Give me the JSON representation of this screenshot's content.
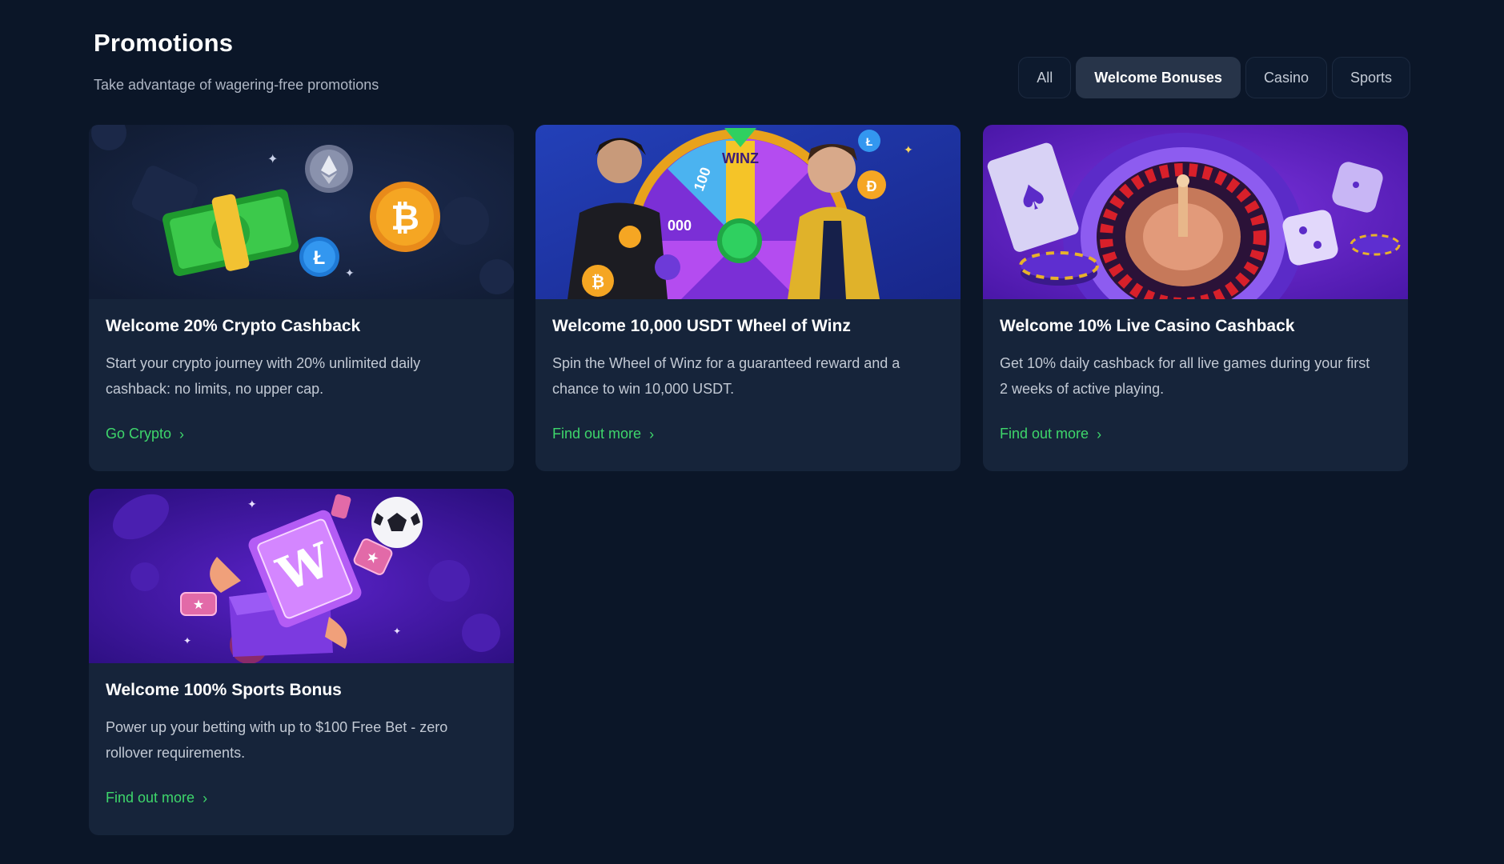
{
  "header": {
    "title": "Promotions",
    "subtitle": "Take advantage of wagering-free promotions"
  },
  "filters": {
    "tabs": [
      {
        "label": "All"
      },
      {
        "label": "Welcome Bonuses"
      },
      {
        "label": "Casino"
      },
      {
        "label": "Sports"
      }
    ],
    "active": "Welcome Bonuses"
  },
  "promotions": [
    {
      "title": "Welcome 20% Crypto Cashback",
      "description": "Start your crypto journey with 20% unlimited daily cashback: no limits, no upper cap.",
      "link": "Go Crypto",
      "art_bg": "#14203a"
    },
    {
      "title": "Welcome 10,000 USDT Wheel of Winz",
      "description": "Spin the Wheel of Winz for a guaranteed reward and a chance to win 10,000 USDT.",
      "link": "Find out more",
      "art_bg": "#1f3a9a",
      "art_text": [
        "100",
        "WINZ",
        "000"
      ]
    },
    {
      "title": "Welcome 10% Live Casino Cashback",
      "description": "Get 10% daily cashback for all live games during your first 2 weeks of active playing.",
      "link": "Find out more",
      "art_bg": "#5a20b8"
    },
    {
      "title": "Welcome 100% Sports Bonus",
      "description": "Power up your betting with up to $100 Free Bet - zero rollover requirements.",
      "link": "Find out more",
      "art_bg": "#3b1595",
      "art_text": [
        "W"
      ]
    }
  ],
  "colors": {
    "page_bg": "#0b1628",
    "card_bg": "#16243a",
    "accent_green": "#3ed66b",
    "active_tab_bg": "#273449"
  },
  "icons": {
    "link_arrow": "chevron-right-icon"
  }
}
